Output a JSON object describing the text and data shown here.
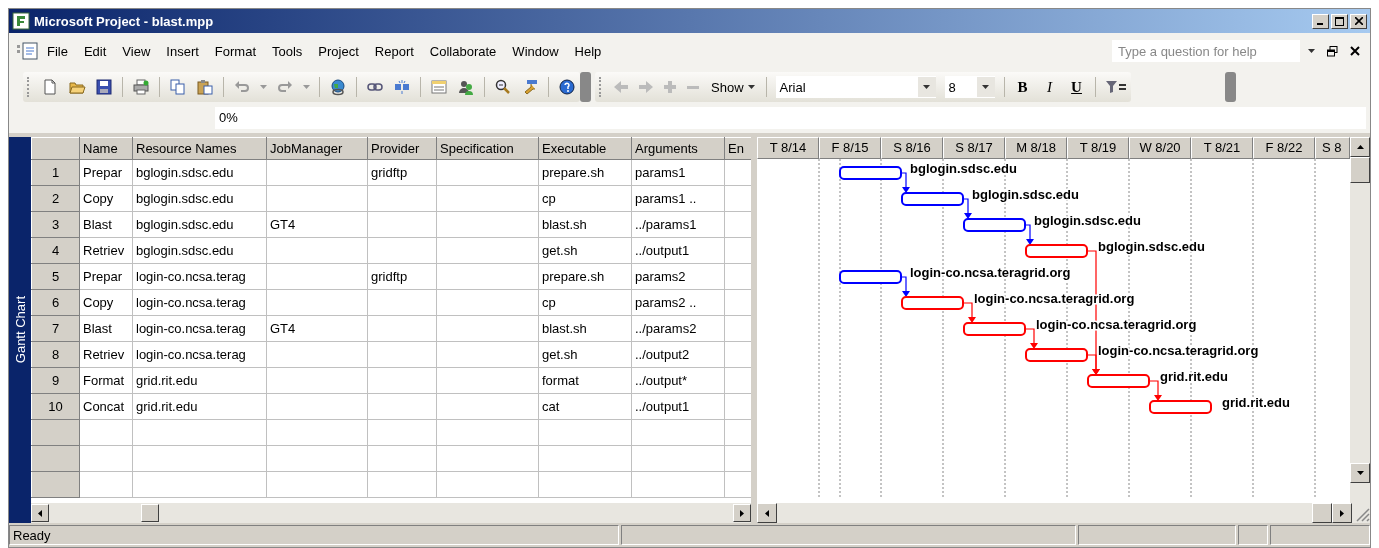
{
  "window": {
    "title": "Microsoft Project - blast.mpp"
  },
  "menu": [
    "File",
    "Edit",
    "View",
    "Insert",
    "Format",
    "Tools",
    "Project",
    "Report",
    "Collaborate",
    "Window",
    "Help"
  ],
  "help_box": {
    "placeholder": "Type a question for help"
  },
  "toolbar": {
    "show_button": "Show",
    "font": "Arial",
    "font_size": "8",
    "bold": "B",
    "italic": "I",
    "underline": "U"
  },
  "entry_bar": {
    "value": "0%"
  },
  "view_bar": {
    "label": "Gantt Chart"
  },
  "table": {
    "columns": [
      "Name",
      "Resource Names",
      "JobManager",
      "Provider",
      "Specification",
      "Executable",
      "Arguments",
      "En"
    ],
    "rows": [
      {
        "id": "1",
        "cells": [
          "Prepar",
          "bglogin.sdsc.edu",
          null,
          "gridftp",
          null,
          "prepare.sh",
          "params1",
          null
        ]
      },
      {
        "id": "2",
        "cells": [
          "Copy",
          "bglogin.sdsc.edu",
          null,
          null,
          null,
          "cp",
          "params1 ..",
          null
        ]
      },
      {
        "id": "3",
        "cells": [
          "Blast",
          "bglogin.sdsc.edu",
          "GT4",
          null,
          null,
          "blast.sh",
          "../params1",
          null
        ]
      },
      {
        "id": "4",
        "cells": [
          "Retriev",
          "bglogin.sdsc.edu",
          null,
          null,
          null,
          "get.sh",
          "../output1",
          null
        ]
      },
      {
        "id": "5",
        "cells": [
          "Prepar",
          "login-co.ncsa.terag",
          null,
          "gridftp",
          null,
          "prepare.sh",
          "params2",
          null
        ]
      },
      {
        "id": "6",
        "cells": [
          "Copy",
          "login-co.ncsa.terag",
          null,
          null,
          null,
          "cp",
          "params2 ..",
          null
        ]
      },
      {
        "id": "7",
        "cells": [
          "Blast",
          "login-co.ncsa.terag",
          "GT4",
          null,
          null,
          "blast.sh",
          "../params2",
          null
        ]
      },
      {
        "id": "8",
        "cells": [
          "Retriev",
          "login-co.ncsa.terag",
          null,
          null,
          null,
          "get.sh",
          "../output2",
          null
        ]
      },
      {
        "id": "9",
        "cells": [
          "Format",
          "grid.rit.edu",
          null,
          null,
          null,
          "format",
          "../output*",
          null
        ]
      },
      {
        "id": "10",
        "cells": [
          "Concat",
          "grid.rit.edu",
          null,
          null,
          null,
          "cat",
          "../output1",
          null
        ]
      }
    ]
  },
  "gantt": {
    "timescale": [
      "T 8/14",
      "F 8/15",
      "S 8/16",
      "S 8/17",
      "M 8/18",
      "T 8/19",
      "W 8/20",
      "T 8/21",
      "F 8/22",
      "S 8"
    ],
    "bars": [
      {
        "label": "bglogin.sdsc.edu",
        "kind": "chain_start",
        "critical": false
      },
      {
        "label": "bglogin.sdsc.edu",
        "kind": "follows",
        "critical": false
      },
      {
        "label": "bglogin.sdsc.edu",
        "kind": "follows",
        "critical": false
      },
      {
        "label": "bglogin.sdsc.edu",
        "kind": "follows",
        "critical": true
      },
      {
        "label": "login-co.ncsa.teragrid.org",
        "kind": "chain_start",
        "critical": false
      },
      {
        "label": "login-co.ncsa.teragrid.org",
        "kind": "follows",
        "critical": true
      },
      {
        "label": "login-co.ncsa.teragrid.org",
        "kind": "follows",
        "critical": true
      },
      {
        "label": "login-co.ncsa.teragrid.org",
        "kind": "follows",
        "critical": true
      },
      {
        "label": "grid.rit.edu",
        "kind": "merge",
        "critical": true
      },
      {
        "label": "grid.rit.edu",
        "kind": "follows",
        "critical": true
      }
    ]
  },
  "status_bar": {
    "text": "Ready"
  }
}
